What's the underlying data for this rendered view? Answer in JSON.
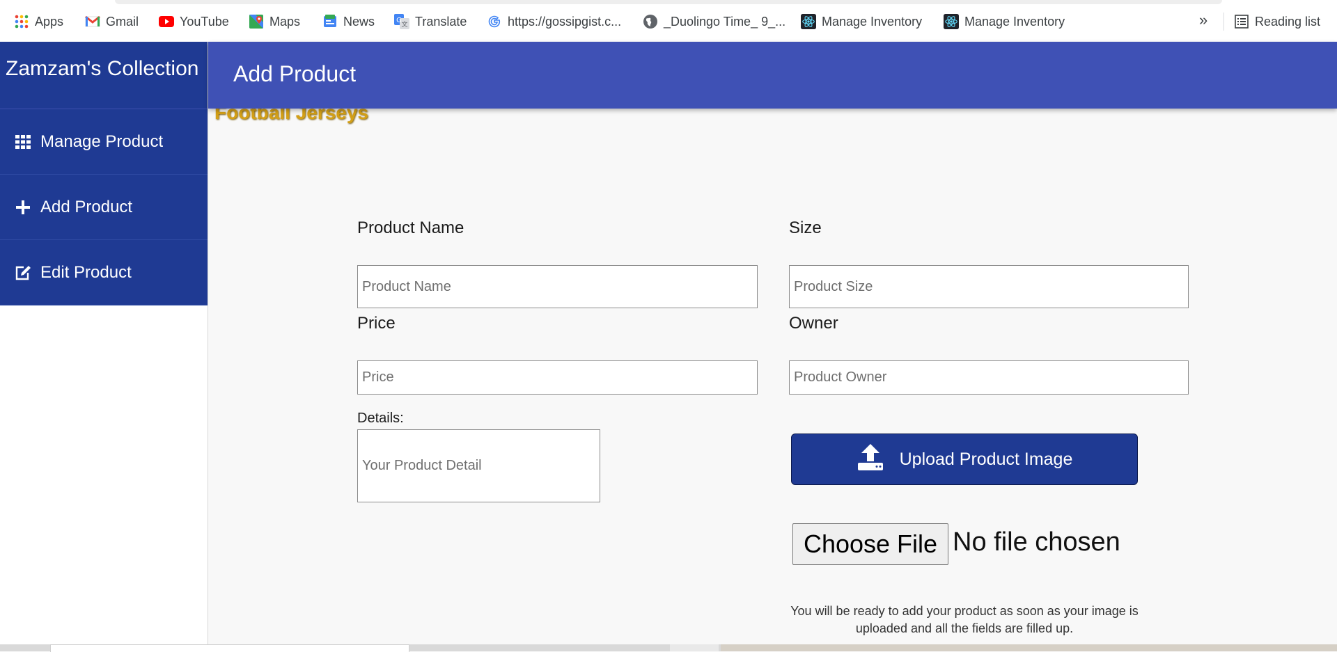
{
  "bookmarks": {
    "items": [
      {
        "label": "Apps",
        "icon": "apps-grid-icon"
      },
      {
        "label": "Gmail",
        "icon": "gmail-icon"
      },
      {
        "label": "YouTube",
        "icon": "youtube-icon"
      },
      {
        "label": "Maps",
        "icon": "maps-icon"
      },
      {
        "label": "News",
        "icon": "news-icon"
      },
      {
        "label": "Translate",
        "icon": "translate-icon"
      },
      {
        "label": "https://gossipgist.c...",
        "icon": "google-icon"
      },
      {
        "label": "_Duolingo Time_ 9_...",
        "icon": "globe-icon"
      },
      {
        "label": "Manage Inventory",
        "icon": "react-icon"
      },
      {
        "label": "Manage Inventory",
        "icon": "react-icon"
      }
    ],
    "more": "»",
    "reading_list": "Reading list"
  },
  "sidebar": {
    "brand": "Zamzam's Collection",
    "items": [
      {
        "label": "Manage Product",
        "icon": "grid-icon"
      },
      {
        "label": "Add Product",
        "icon": "plus-icon"
      },
      {
        "label": "Edit Product",
        "icon": "edit-icon"
      }
    ]
  },
  "header": {
    "title": "Add Product"
  },
  "store_name": "Football Jerseys",
  "form": {
    "name_label": "Product Name",
    "name_placeholder": "Product Name",
    "size_label": "Size",
    "size_placeholder": "Product Size",
    "price_label": "Price",
    "price_placeholder": "Price",
    "owner_label": "Owner",
    "owner_placeholder": "Product Owner",
    "details_label": "Details:",
    "details_placeholder": "Your Product Detail",
    "upload_label": "Upload Product Image",
    "choose_file": "Choose File",
    "no_file": "No file chosen",
    "note": "You will be ready to add your product as soon as your image is uploaded and all the fields are filled up."
  },
  "colors": {
    "sidebar_bg": "#1f3a93",
    "header_bg": "#3f51b5",
    "store_name": "#d4a017"
  }
}
